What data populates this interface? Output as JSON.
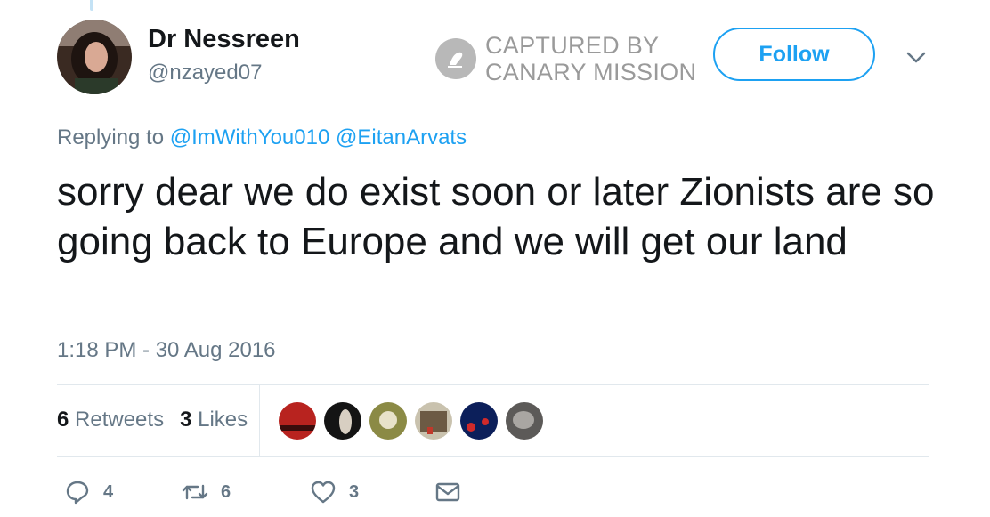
{
  "author": {
    "display_name": "Dr Nessreen",
    "handle": "@nzayed07"
  },
  "watermark": {
    "line1": "CAPTURED BY",
    "line2": "CANARY MISSION"
  },
  "follow_label": "Follow",
  "reply": {
    "prefix": "Replying to",
    "mention1": "@ImWithYou010",
    "mention2": "@EitanArvats"
  },
  "tweet_text": "sorry dear we do exist soon or later Zionists are so going back to Europe and we will get our land",
  "timestamp": "1:18 PM - 30 Aug 2016",
  "stats": {
    "retweets_count": "6",
    "retweets_label": "Retweets",
    "likes_count": "3",
    "likes_label": "Likes"
  },
  "actions": {
    "reply_count": "4",
    "retweet_count": "6",
    "like_count": "3"
  },
  "colors": {
    "accent": "#1da1f2",
    "muted": "#657786",
    "text": "#14171a"
  }
}
